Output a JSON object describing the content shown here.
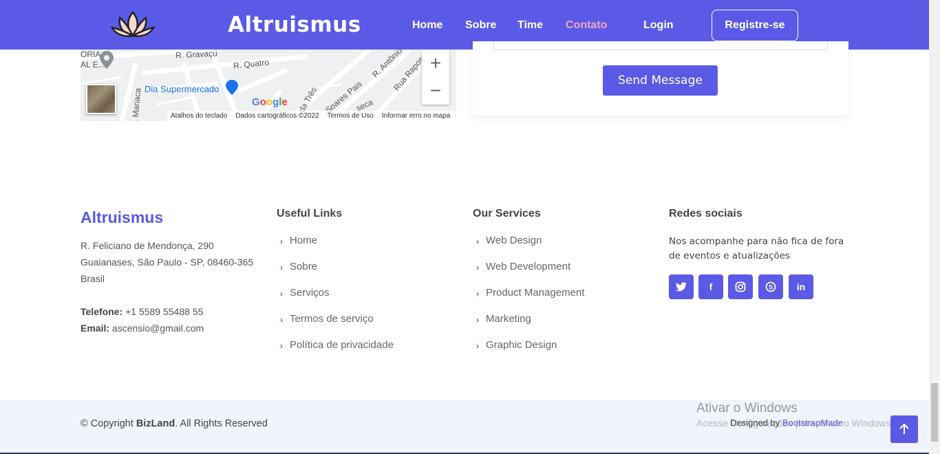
{
  "header": {
    "brand": "Altruismus",
    "nav": [
      {
        "label": "Home",
        "active": false
      },
      {
        "label": "Sobre",
        "active": false
      },
      {
        "label": "Time",
        "active": false
      },
      {
        "label": "Contato",
        "active": true
      },
      {
        "label": "Login",
        "active": false
      }
    ],
    "register_label": "Registre-se",
    "logo_icon": "lotus-icon"
  },
  "map": {
    "labels": [
      "ORIA",
      "AL E...",
      "R. Gravaçu",
      "R. Quatro",
      "R. Antônio",
      "Rua Rapos",
      "Dia Supermercado",
      "R. Mariaca",
      "da Três",
      "Soares Pais",
      "seca"
    ],
    "google": "Google",
    "footer": [
      "Atalhos do teclado",
      "Dados cartográficos ©2022",
      "Termos de Uso",
      "Informar erro no mapa"
    ],
    "zoom_in": "+",
    "zoom_out": "−"
  },
  "form": {
    "send_label": "Send Message"
  },
  "footer": {
    "brand": "Altruismus",
    "address": [
      "R. Feliciano de Mendonça, 290",
      "Guaianases, São Paulo - SP, 08460-365",
      "Brasil"
    ],
    "phone_label": "Telefone:",
    "phone": "+1 5589 55488 55",
    "email_label": "Email:",
    "email": "ascensio@gmail.com",
    "useful_links_title": "Useful Links",
    "useful_links": [
      "Home",
      "Sobre",
      "Serviços",
      "Termos de serviço",
      "Política de privacidade"
    ],
    "services_title": "Our Services",
    "services": [
      "Web Design",
      "Web Development",
      "Product Management",
      "Marketing",
      "Graphic Design"
    ],
    "social_title": "Redes sociais",
    "social_text": "Nos acompanhe para não fica de fora de eventos e atualizações",
    "social": [
      {
        "icon": "twitter-icon",
        "glyph": "t"
      },
      {
        "icon": "facebook-icon",
        "glyph": "f"
      },
      {
        "icon": "instagram-icon",
        "glyph": "◎"
      },
      {
        "icon": "skype-icon",
        "glyph": "S"
      },
      {
        "icon": "linkedin-icon",
        "glyph": "in"
      }
    ],
    "copyright_prefix": "© Copyright ",
    "copyright_brand": "BizLand",
    "copyright_suffix": ". All Rights Reserved",
    "designed_by": "Designed by ",
    "designer": "BootstrapMade"
  },
  "windows_watermark": {
    "title": "Ativar o Windows",
    "subtitle": "Acesse Configurações para ativar o Windows."
  },
  "colors": {
    "primary": "#5a5ae6",
    "active_nav": "#f7a1c4"
  }
}
